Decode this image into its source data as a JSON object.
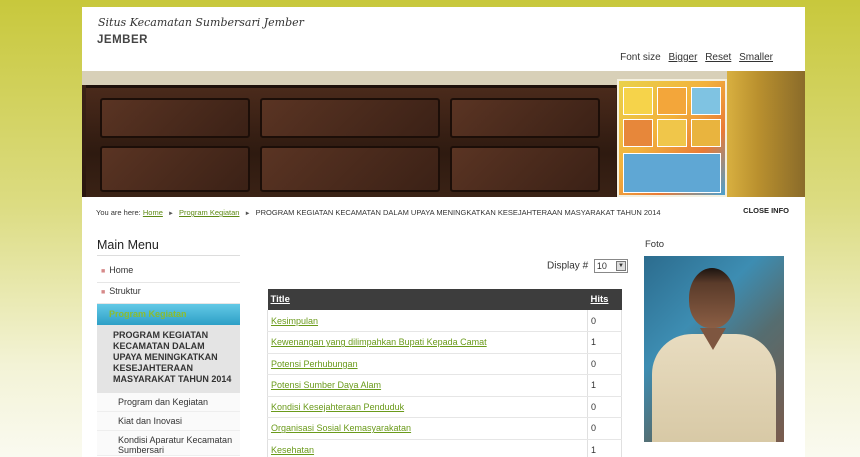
{
  "header": {
    "site_title": "Situs Kecamatan Sumbersari Jember",
    "site_subtitle": "JEMBER",
    "font_size_label": "Font size",
    "bigger": "Bigger",
    "reset": "Reset",
    "smaller": "Smaller"
  },
  "breadcrumb": {
    "prefix": "You are here:",
    "home": "Home",
    "section": "Program Kegiatan",
    "current": "PROGRAM KEGIATAN KECAMATAN DALAM UPAYA MENINGKATKAN KESEJAHTERAAN MASYARAKAT TAHUN 2014",
    "close_info": "CLOSE INFO"
  },
  "menu": {
    "title": "Main Menu",
    "items": [
      {
        "label": "Home"
      },
      {
        "label": "Struktur"
      }
    ],
    "active": "Program Kegiatan",
    "active_sub": "PROGRAM KEGIATAN KECAMATAN DALAM UPAYA MENINGKATKAN KESEJAHTERAAN MASYARAKAT TAHUN 2014",
    "sub_items": [
      {
        "label": "Program dan Kegiatan"
      },
      {
        "label": "Kiat dan Inovasi"
      },
      {
        "label": "Kondisi Aparatur Kecamatan Sumbersari"
      }
    ]
  },
  "display": {
    "label": "Display #",
    "value": "10"
  },
  "table": {
    "col_title": "Title",
    "col_hits": "Hits",
    "rows": [
      {
        "title": "Kesimpulan",
        "hits": "0"
      },
      {
        "title": "Kewenangan yang dilimpahkan Bupati Kepada Camat",
        "hits": "1"
      },
      {
        "title": "Potensi Perhubungan",
        "hits": "0"
      },
      {
        "title": "Potensi Sumber Daya Alam",
        "hits": "1"
      },
      {
        "title": "Kondisi Kesejahteraan Penduduk",
        "hits": "0"
      },
      {
        "title": "Organisasi Sosial Kemasyarakatan",
        "hits": "0"
      },
      {
        "title": "Kesehatan",
        "hits": "1"
      }
    ]
  },
  "sidebar_right": {
    "foto_label": "Foto"
  },
  "colors": {
    "link_green": "#6a9a1a",
    "menu_active_blue": "#2d9fc6",
    "table_header": "#3d3d3d",
    "outer_background": "#c8c83c"
  }
}
